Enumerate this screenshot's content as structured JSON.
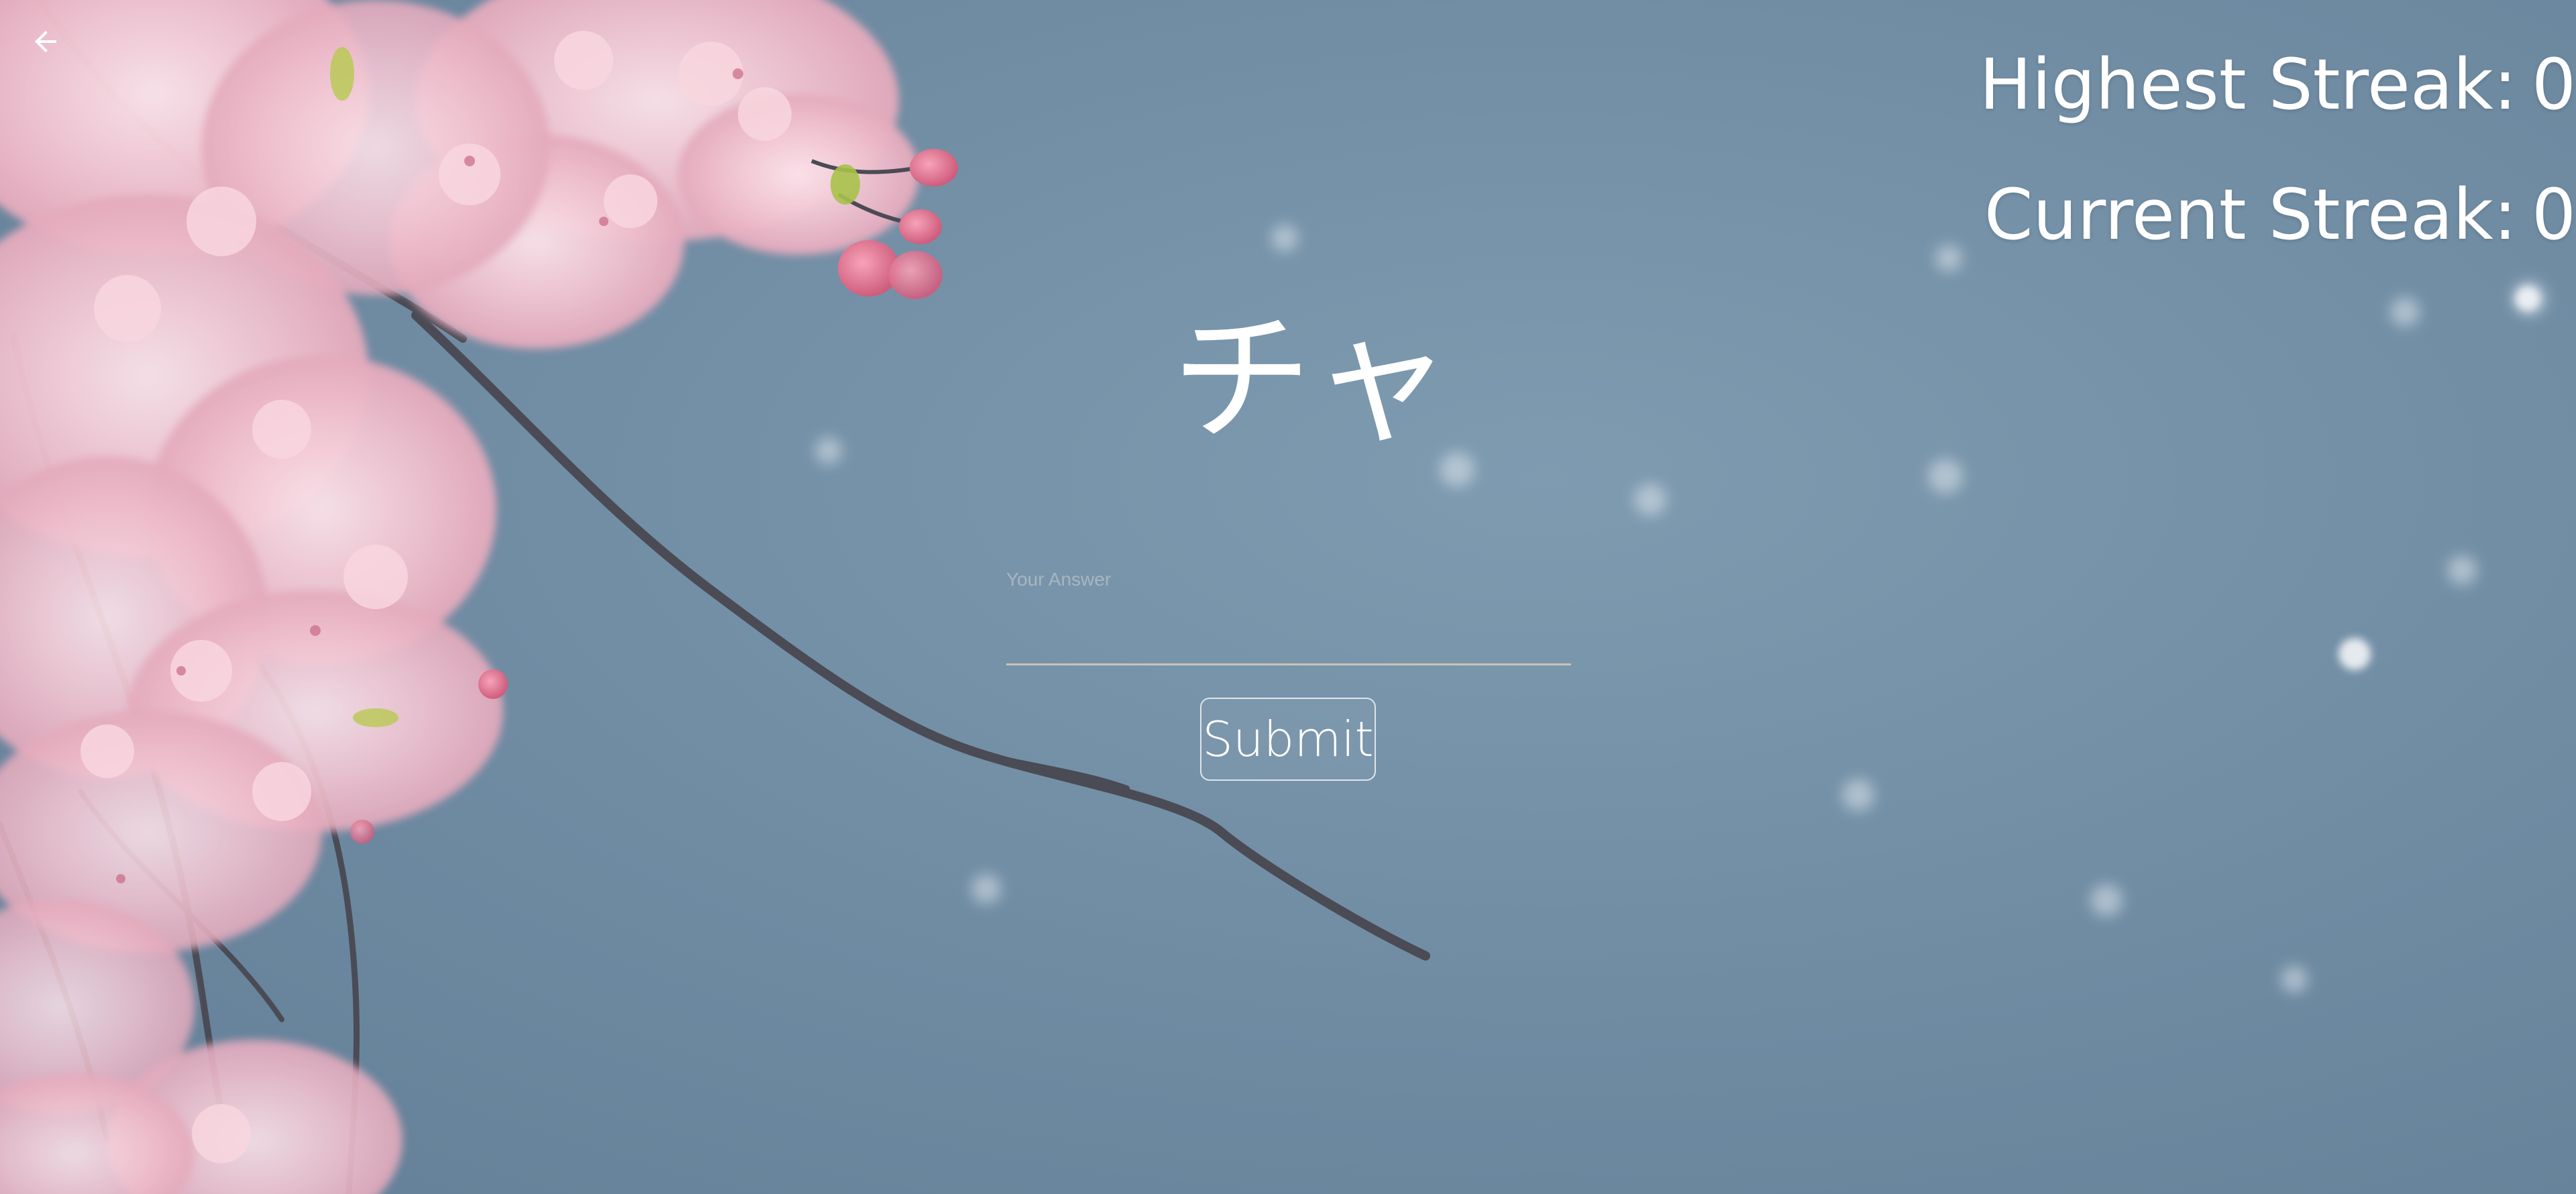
{
  "nav": {
    "back_icon": "arrow-left-icon"
  },
  "stats": {
    "highest_label": "Highest Streak:",
    "highest_value": "0",
    "current_label": "Current Streak:",
    "current_value": "0"
  },
  "quiz": {
    "character": "チャ",
    "answer_label": "Your Answer",
    "answer_value": "",
    "submit_label": "Submit"
  },
  "background": {
    "description_icon": "cherry-blossom-background",
    "sky_color": "#6f8ba2",
    "blossom_color": "#f2c6d2",
    "bud_color": "#e07d97",
    "branch_color": "#4a4b55"
  }
}
